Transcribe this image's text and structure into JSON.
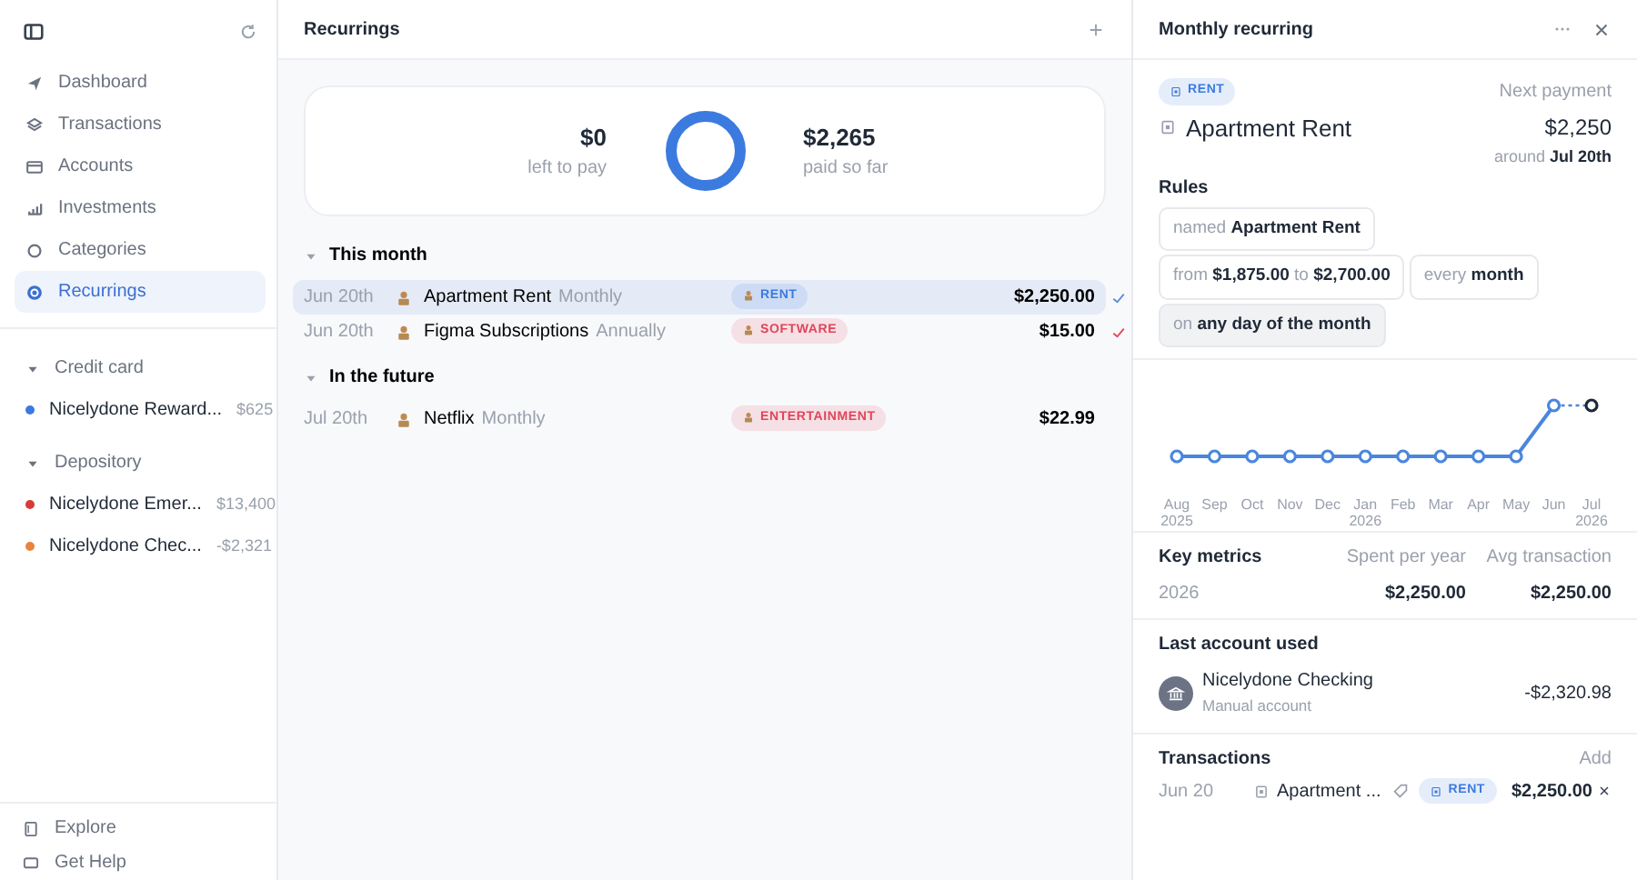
{
  "sidebar": {
    "nav": [
      {
        "label": "Dashboard",
        "selected": false
      },
      {
        "label": "Transactions",
        "selected": false
      },
      {
        "label": "Accounts",
        "selected": false
      },
      {
        "label": "Investments",
        "selected": false
      },
      {
        "label": "Categories",
        "selected": false
      },
      {
        "label": "Recurrings",
        "selected": true
      }
    ],
    "groups": [
      {
        "label": "Credit card",
        "expanded": true,
        "accounts": [
          {
            "name": "Nicelydone Reward...",
            "balance": "$625",
            "color": "#3b7be0"
          }
        ]
      },
      {
        "label": "Depository",
        "expanded": true,
        "accounts": [
          {
            "name": "Nicelydone Emer...",
            "balance": "$13,400",
            "color": "#d93a3a"
          },
          {
            "name": "Nicelydone Chec...",
            "balance": "-$2,321",
            "color": "#e8843c"
          }
        ]
      }
    ],
    "footer": [
      {
        "label": "Explore"
      },
      {
        "label": "Get Help"
      }
    ]
  },
  "main": {
    "title": "Recurrings",
    "summary": {
      "left_amount": "$0",
      "left_label": "left to pay",
      "paid_amount": "$2,265",
      "paid_label": "paid so far",
      "level": 1
    },
    "sections": [
      {
        "title": "This month",
        "expanded": true,
        "rows": [
          {
            "date": "Jun 20th",
            "name": "Apartment Rent",
            "frequency": "Monthly",
            "tag": "RENT",
            "color": "#3b7be0",
            "amount": "$2,250.00",
            "check": {
              "checked": true,
              "color": "#5a8ad6"
            },
            "selected": true
          },
          {
            "date": "Jun 20th",
            "name": "Figma Subscriptions",
            "frequency": "Annually",
            "tag": "SOFTWARE",
            "color": "#e0455a",
            "amount": "$15.00",
            "check": {
              "checked": true,
              "color": "#e0455a"
            },
            "selected": false
          }
        ]
      },
      {
        "title": "In the future",
        "expanded": true,
        "rows": [
          {
            "date": "Jul 20th",
            "name": "Netflix",
            "frequency": "Monthly",
            "tag": "ENTERTAINMENT",
            "color": "#e0455a",
            "amount": "$22.99",
            "check": {
              "checked": false
            },
            "selected": false
          }
        ]
      }
    ]
  },
  "detail": {
    "title": "Monthly recurring",
    "tag": "RENT",
    "name": "Apartment Rent",
    "next_label": "Next payment",
    "next_amount": "$2,250",
    "around_label": "around",
    "around_date": "Jul 20th",
    "rules_title": "Rules",
    "rules": [
      {
        "text": "named **Apartment Rent**",
        "selected": false
      },
      {
        "text": "from **$1,875.00** to **$2,700.00**",
        "selected": false
      },
      {
        "text": "every **month**",
        "selected": false
      },
      {
        "text": "on **any day of the month**",
        "selected": true
      }
    ],
    "chart": {
      "x_labels": [
        "Aug\n2025",
        "Sep",
        "Oct",
        "Nov",
        "Dec",
        "Jan\n2026",
        "Feb",
        "Mar",
        "Apr",
        "May",
        "Jun",
        "Jul\n2026"
      ]
    },
    "metrics": {
      "title": "Key metrics",
      "columns": [
        "Spent per year",
        "Avg transaction"
      ],
      "rows": [
        {
          "label": "2026",
          "values": [
            "$2,250.00",
            "$2,250.00"
          ]
        }
      ]
    },
    "last_account": {
      "title": "Last account used",
      "name": "Nicelydone Checking",
      "subtitle": "Manual account",
      "amount": "-$2,320.98"
    },
    "transactions": {
      "title": "Transactions",
      "action": "Add",
      "rows": [
        {
          "date": "Jun 20",
          "name": "Apartment ...",
          "tag": "RENT",
          "amount": "$2,250.00"
        }
      ]
    }
  }
}
